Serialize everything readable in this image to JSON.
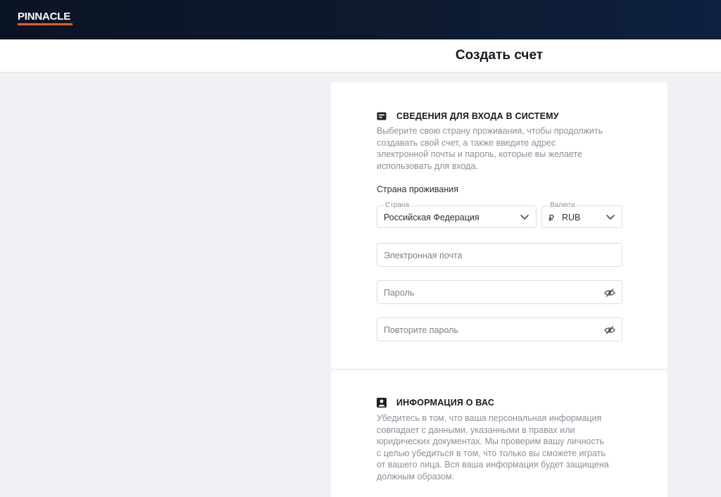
{
  "header": {
    "logo_text": "PINNACLE",
    "brand_accent": "#ff5a1f"
  },
  "page": {
    "title": "Создать счет"
  },
  "login_section": {
    "icon": "id-card-icon",
    "title": "СВЕДЕНИЯ ДЛЯ ВХОДА В СИСТЕМУ",
    "description_lines": [
      "Выберите свою страну проживания, чтобы продолжить",
      "создавать свой счет, а также введите адрес",
      "электронной почты и пароль, которые вы желаете",
      "использовать для входа."
    ],
    "residence_label": "Страна проживания",
    "country": {
      "label": "Страна",
      "value": "Российская Федерация"
    },
    "currency": {
      "label": "Валюта",
      "symbol": "₽",
      "value": "RUB"
    },
    "email": {
      "placeholder": "Электронная почта"
    },
    "password": {
      "placeholder": "Пароль"
    },
    "password_repeat": {
      "placeholder": "Повторите пароль"
    }
  },
  "about_section": {
    "icon": "user-icon",
    "title": "ИНФОРМАЦИЯ О ВАС",
    "description_lines": [
      "Убедитесь в том, что ваша персональная информация",
      "совпадает с данными, указанными в правах или",
      "юридических документах. Мы проверим вашу личность",
      "с целью убедиться в том, что только вы сможете играть",
      "от вашего лица. Вся ваша информация будет защищена",
      "должным образом."
    ]
  }
}
